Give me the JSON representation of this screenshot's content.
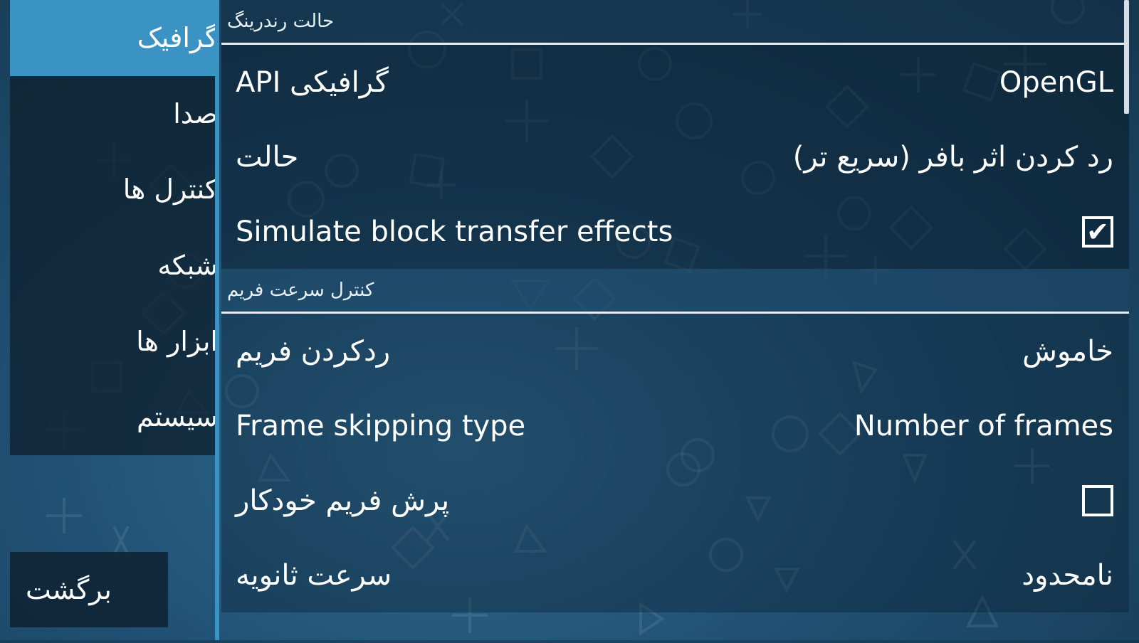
{
  "nav": {
    "items": [
      {
        "label": "گرافیک",
        "active": true
      },
      {
        "label": "صدا",
        "active": false
      },
      {
        "label": "کنترل ها",
        "active": false
      },
      {
        "label": "شبکه",
        "active": false
      },
      {
        "label": "ابزار ها",
        "active": false
      },
      {
        "label": "سیستم",
        "active": false
      }
    ],
    "back_label": "برگشت"
  },
  "sections": [
    {
      "title": "حالت رندرینگ",
      "rows": [
        {
          "label": "API گرافیکی",
          "value": "OpenGL",
          "type": "choice"
        },
        {
          "label": "حالت",
          "value": "رد کردن اثر بافر (سریع تر)",
          "type": "choice"
        },
        {
          "label": "Simulate block transfer effects",
          "checked": true,
          "type": "checkbox"
        }
      ]
    },
    {
      "title": "کنترل سرعت فریم",
      "rows": [
        {
          "label": "ردکردن فریم",
          "value": "خاموش",
          "type": "choice"
        },
        {
          "label": "Frame skipping type",
          "value": "Number of frames",
          "type": "choice"
        },
        {
          "label": "پرش فریم خودکار",
          "checked": false,
          "type": "checkbox"
        },
        {
          "label": "سرعت ثانویه",
          "value": "نامحدود",
          "type": "choice"
        }
      ]
    }
  ],
  "icons": {
    "check": "check-icon",
    "background": "ps-symbols-pattern"
  },
  "colors": {
    "accent": "#3a93c2",
    "background": "#1f4f72",
    "text": "#ffffff"
  }
}
